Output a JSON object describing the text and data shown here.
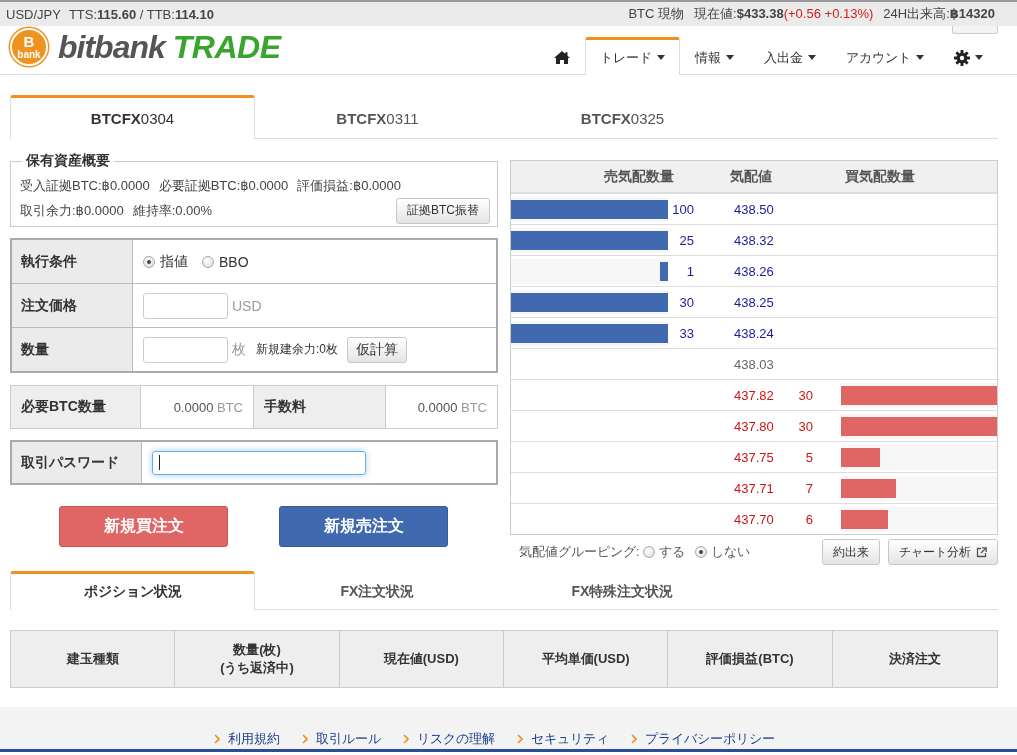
{
  "ticker_bar": {
    "pair": "USD/JPY",
    "rates": "TTS:**115.60** / TTB:**114.10**",
    "market": "BTC 現物",
    "current_price": "現在値:**$433.38**",
    "change": "(+0.56 +0.13%)",
    "volume": "24H出来高:**฿14320**"
  },
  "header": {
    "logo": {
      "coin_symbol": "B",
      "coin_caption": "bank",
      "name": "bitbank",
      "suffix": "TRADE"
    },
    "nav": [
      {
        "kind": "home",
        "selected": false,
        "menu": false
      },
      {
        "kind": "text",
        "label": "トレード",
        "selected": true,
        "menu": true
      },
      {
        "kind": "text",
        "label": "情報",
        "selected": false,
        "menu": true
      },
      {
        "kind": "text",
        "label": "入出金",
        "selected": false,
        "menu": true
      },
      {
        "kind": "text",
        "label": "アカウント",
        "selected": false,
        "menu": true
      },
      {
        "kind": "settings",
        "selected": false,
        "menu": true
      }
    ]
  },
  "contract_tabs": [
    {
      "label": "**BTCFX**0304",
      "selected": true
    },
    {
      "label": "**BTCFX**0311",
      "selected": false
    },
    {
      "label": "**BTCFX**0325",
      "selected": false
    }
  ],
  "asset_summary": {
    "title": "保有資産概要",
    "rows": [
      {
        "items": [
          "受入証拠BTC:฿0.0000",
          "必要証拠BTC:฿0.0000",
          "評価損益:฿0.0000"
        ]
      },
      {
        "items": [
          "取引余力:฿0.0000",
          "維持率:0.00%"
        ],
        "button": "証拠BTC振替"
      }
    ]
  },
  "order_form": {
    "rows": [
      {
        "kind": "radio",
        "label": "執行条件",
        "options": [
          {
            "label": "指値",
            "selected": true
          },
          {
            "label": "BBO",
            "selected": false
          }
        ]
      },
      {
        "kind": "input",
        "label": "注文価格",
        "unit": "USD"
      },
      {
        "kind": "input",
        "label": "数量",
        "unit": "枚",
        "note": "新規建余力:0枚",
        "button": "仮計算"
      }
    ]
  },
  "requirements": [
    {
      "label": "必要BTC数量",
      "value": "0.0000",
      "unit": "BTC"
    },
    {
      "label": "手数料",
      "value": "0.0000",
      "unit": "BTC"
    }
  ],
  "password": {
    "label": "取引パスワード",
    "focused": true
  },
  "order_buttons": [
    {
      "kind": "buy",
      "label": "新規買注文"
    },
    {
      "kind": "sell",
      "label": "新規売注文"
    }
  ],
  "order_book": {
    "columns": [
      "売気配数量",
      "気配値",
      "買気配数量"
    ],
    "rows": [
      {
        "kind": "ask",
        "quantity": "100",
        "price": "438.50",
        "level": 1
      },
      {
        "kind": "ask",
        "quantity": "25",
        "price": "438.32",
        "level": 1
      },
      {
        "kind": "ask",
        "quantity": "1",
        "price": "438.26",
        "level": 0.05
      },
      {
        "kind": "ask",
        "quantity": "30",
        "price": "438.25",
        "level": 1
      },
      {
        "kind": "ask",
        "quantity": "33",
        "price": "438.24",
        "level": 1
      },
      {
        "kind": "mid",
        "price": "438.03"
      },
      {
        "kind": "bid",
        "price": "437.82",
        "quantity": "30",
        "level": 1
      },
      {
        "kind": "bid",
        "price": "437.80",
        "quantity": "30",
        "level": 1
      },
      {
        "kind": "bid",
        "price": "437.75",
        "quantity": "5",
        "level": 0.25
      },
      {
        "kind": "bid",
        "price": "437.71",
        "quantity": "7",
        "level": 0.35
      },
      {
        "kind": "bid",
        "price": "437.70",
        "quantity": "6",
        "level": 0.3
      }
    ]
  },
  "grouping": {
    "label": "気配値グルーピング:",
    "options": [
      {
        "label": "する",
        "selected": false
      },
      {
        "label": "しない",
        "selected": true
      }
    ],
    "buttons": [
      {
        "label": "約出来",
        "external": false
      },
      {
        "label": "チャート分析",
        "external": true
      }
    ]
  },
  "status_tabs": [
    {
      "label": "ポジション状況",
      "selected": true
    },
    {
      "label": "FX注文状況",
      "selected": false
    },
    {
      "label": "FX特殊注文状況",
      "selected": false
    }
  ],
  "positions_table": {
    "columns": [
      "建玉種類",
      "数量(枚)\n(うち返済中)",
      "現在値(USD)",
      "平均単価(USD)",
      "評価損益(BTC)",
      "決済注文"
    ]
  },
  "footer": {
    "links": [
      "利用規約",
      "取引ルール",
      "リスクの理解",
      "セキュリティ",
      "プライバシーポリシー"
    ]
  }
}
